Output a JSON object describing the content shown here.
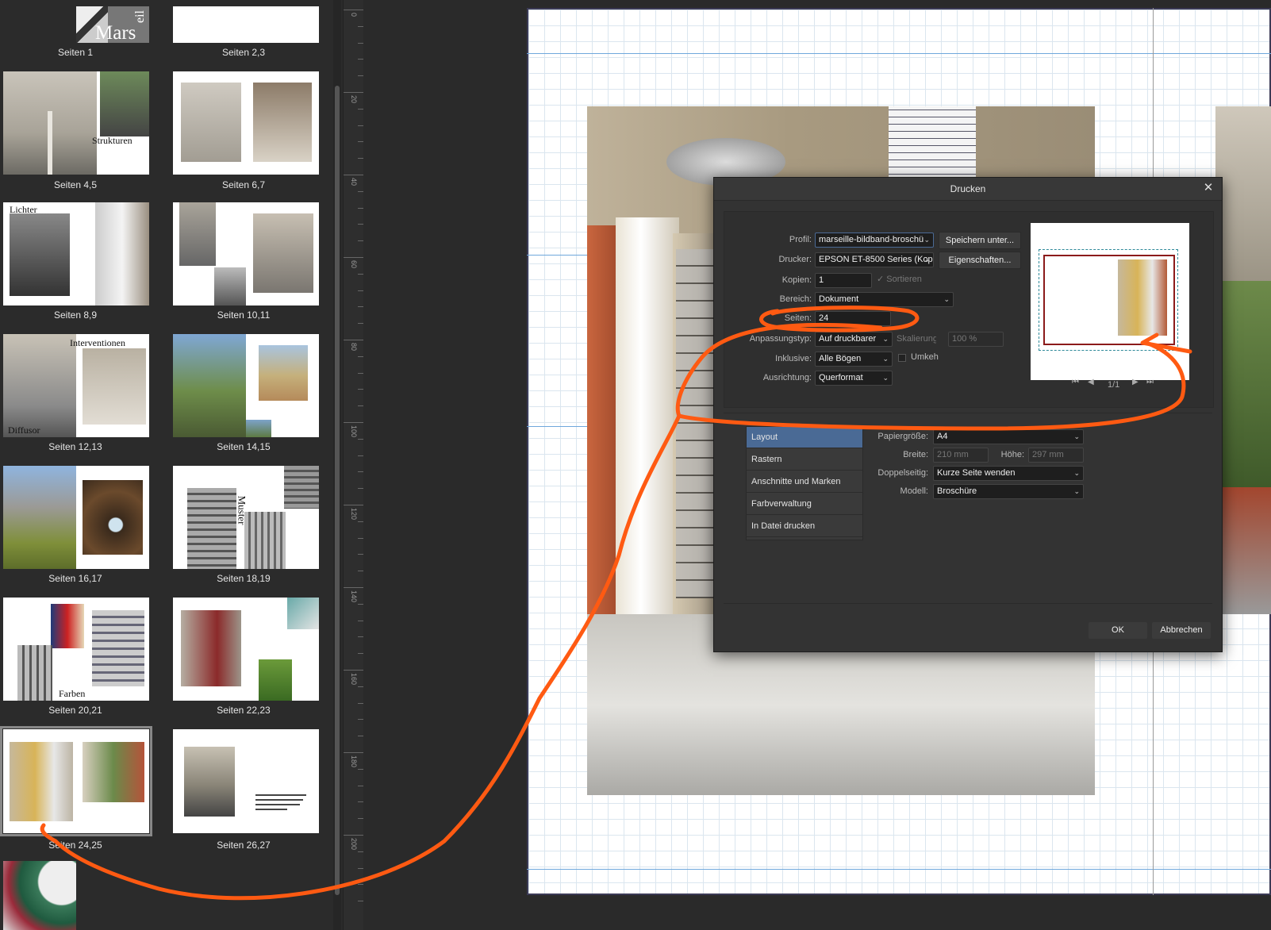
{
  "pages_panel": {
    "thumbnails": [
      {
        "label": "Seiten 1"
      },
      {
        "label": "Seiten 2,3"
      },
      {
        "label": "Seiten 4,5"
      },
      {
        "label": "Seiten 6,7"
      },
      {
        "label": "Seiten 8,9"
      },
      {
        "label": "Seiten 10,11"
      },
      {
        "label": "Seiten 12,13"
      },
      {
        "label": "Seiten 14,15"
      },
      {
        "label": "Seiten 16,17"
      },
      {
        "label": "Seiten 18,19"
      },
      {
        "label": "Seiten 20,21"
      },
      {
        "label": "Seiten 22,23"
      },
      {
        "label": "Seiten 24,25"
      },
      {
        "label": "Seiten 26,27"
      }
    ],
    "thumb_texts": {
      "mars": "Mars",
      "eil": "eil",
      "strukturen": "Strukturen",
      "lichter": "Lichter",
      "interventionen": "Interventionen",
      "diffusor": "Diffusor",
      "muster": "Muster",
      "farben": "Farben"
    },
    "selected_index": 12
  },
  "ruler": {
    "labels": [
      "0",
      "20",
      "40",
      "60",
      "80",
      "100",
      "120",
      "140",
      "160",
      "180",
      "200"
    ]
  },
  "dialog": {
    "title": "Drucken",
    "close": "✕",
    "fields": {
      "profil": {
        "label": "Profil:",
        "value": "marseille-bildband-broschü"
      },
      "drucker": {
        "label": "Drucker:",
        "value": "EPSON ET-8500 Series (Kop"
      },
      "kopien": {
        "label": "Kopien:",
        "value": "1"
      },
      "sortieren": {
        "label": "Sortieren"
      },
      "bereich": {
        "label": "Bereich:",
        "value": "Dokument"
      },
      "seiten": {
        "label": "Seiten:",
        "value": "24"
      },
      "anpassungstyp": {
        "label": "Anpassungstyp:",
        "value": "Auf druckbarer"
      },
      "skalierung": {
        "label": "Skalierung",
        "value": "100 %"
      },
      "inklusive": {
        "label": "Inklusive:",
        "value": "Alle Bögen"
      },
      "umkehren": {
        "label": "Umkeh"
      },
      "ausrichtung": {
        "label": "Ausrichtung:",
        "value": "Querformat"
      }
    },
    "buttons": {
      "speichern": "Speichern unter...",
      "eigenschaften": "Eigenschaften...",
      "ok": "OK",
      "abbrechen": "Abbrechen"
    },
    "preview": {
      "page_indicator": "1/1"
    },
    "categories": [
      {
        "label": "Layout",
        "selected": true
      },
      {
        "label": "Rastern"
      },
      {
        "label": "Anschnitte und Marken"
      },
      {
        "label": "Farbverwaltung"
      },
      {
        "label": "In Datei drucken"
      }
    ],
    "layout": {
      "papiergroesse": {
        "label": "Papiergröße:",
        "value": "A4"
      },
      "breite": {
        "label": "Breite:",
        "value": "210 mm"
      },
      "hoehe": {
        "label": "Höhe:",
        "value": "297 mm"
      },
      "doppelseitig": {
        "label": "Doppelseitig:",
        "value": "Kurze Seite wenden"
      },
      "modell": {
        "label": "Modell:",
        "value": "Broschüre"
      }
    }
  },
  "colors": {
    "annotation": "#ff5a12",
    "accent": "#4a6a95",
    "dialog_bg": "#333333"
  }
}
